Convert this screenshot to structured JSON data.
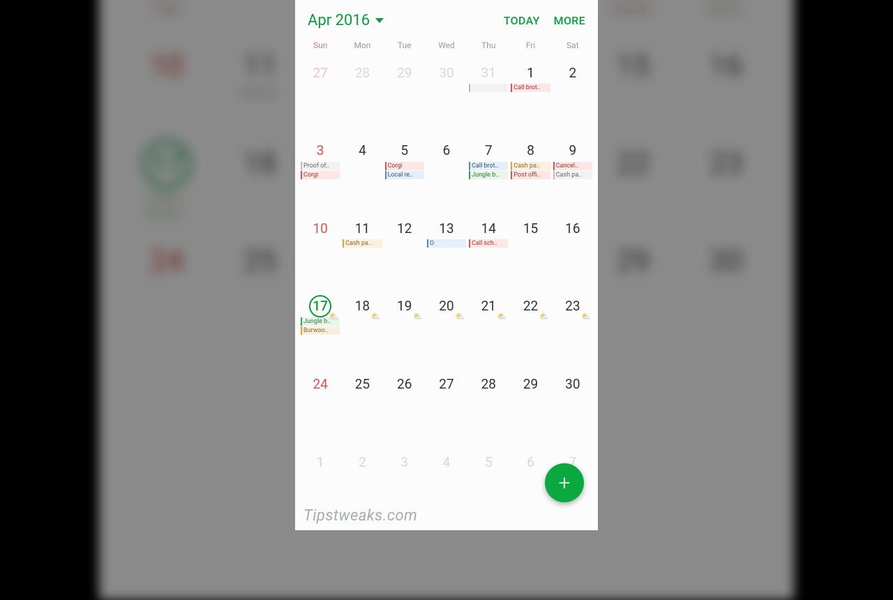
{
  "header": {
    "month_label": "Apr 2016",
    "today_label": "TODAY",
    "more_label": "MORE"
  },
  "dow": [
    "Sun",
    "Mon",
    "Tue",
    "Wed",
    "Thu",
    "Fri",
    "Sat"
  ],
  "weeks": [
    [
      {
        "n": "27",
        "adj": true,
        "sun": true,
        "events": []
      },
      {
        "n": "28",
        "adj": true,
        "events": []
      },
      {
        "n": "29",
        "adj": true,
        "events": []
      },
      {
        "n": "30",
        "adj": true,
        "events": []
      },
      {
        "n": "31",
        "adj": true,
        "events": [
          {
            "t": "",
            "c": "plain"
          }
        ]
      },
      {
        "n": "1",
        "events": [
          {
            "t": "Call brot..",
            "c": "red"
          }
        ]
      },
      {
        "n": "2",
        "events": []
      }
    ],
    [
      {
        "n": "3",
        "sun": true,
        "events": [
          {
            "t": "Proof of..",
            "c": "plain"
          },
          {
            "t": "Corgi",
            "c": "red"
          }
        ]
      },
      {
        "n": "4",
        "events": []
      },
      {
        "n": "5",
        "events": [
          {
            "t": "Corgi",
            "c": "red"
          },
          {
            "t": "Local re..",
            "c": "blue"
          }
        ]
      },
      {
        "n": "6",
        "events": []
      },
      {
        "n": "7",
        "events": [
          {
            "t": "Call brot..",
            "c": "blue"
          },
          {
            "t": "Jungle b..",
            "c": "green"
          }
        ]
      },
      {
        "n": "8",
        "events": [
          {
            "t": "Cash pa..",
            "c": "orange"
          },
          {
            "t": "Post offi..",
            "c": "red"
          }
        ]
      },
      {
        "n": "9",
        "events": [
          {
            "t": "Cancel..",
            "c": "red"
          },
          {
            "t": "Cash pa..",
            "c": "plain"
          }
        ]
      }
    ],
    [
      {
        "n": "10",
        "sun": true,
        "events": []
      },
      {
        "n": "11",
        "events": [
          {
            "t": "Cash pa..",
            "c": "orange"
          }
        ]
      },
      {
        "n": "12",
        "events": []
      },
      {
        "n": "13",
        "events": [
          {
            "t": "O",
            "c": "blue"
          }
        ]
      },
      {
        "n": "14",
        "events": [
          {
            "t": "Call sch..",
            "c": "red"
          }
        ]
      },
      {
        "n": "15",
        "events": []
      },
      {
        "n": "16",
        "events": []
      }
    ],
    [
      {
        "n": "17",
        "sun": true,
        "today": true,
        "wx": true,
        "events": [
          {
            "t": "Jungle b..",
            "c": "green"
          },
          {
            "t": "Burwoo..",
            "c": "orange"
          }
        ]
      },
      {
        "n": "18",
        "wx": true,
        "events": []
      },
      {
        "n": "19",
        "wx": true,
        "events": []
      },
      {
        "n": "20",
        "wx": true,
        "events": []
      },
      {
        "n": "21",
        "wx": true,
        "events": []
      },
      {
        "n": "22",
        "wx": true,
        "events": []
      },
      {
        "n": "23",
        "wx": true,
        "events": []
      }
    ],
    [
      {
        "n": "24",
        "sun": true,
        "events": []
      },
      {
        "n": "25",
        "events": []
      },
      {
        "n": "26",
        "events": []
      },
      {
        "n": "27",
        "events": []
      },
      {
        "n": "28",
        "events": []
      },
      {
        "n": "29",
        "events": []
      },
      {
        "n": "30",
        "events": []
      }
    ],
    [
      {
        "n": "1",
        "adj": true,
        "sun": true,
        "events": []
      },
      {
        "n": "2",
        "adj": true,
        "events": []
      },
      {
        "n": "3",
        "adj": true,
        "events": []
      },
      {
        "n": "4",
        "adj": true,
        "events": []
      },
      {
        "n": "5",
        "adj": true,
        "events": []
      },
      {
        "n": "6",
        "adj": true,
        "events": []
      },
      {
        "n": "7",
        "adj": true,
        "events": []
      }
    ]
  ],
  "fab": {
    "label": "+"
  },
  "watermark": "Tipstweaks.com",
  "weather_glyph": "⛅"
}
